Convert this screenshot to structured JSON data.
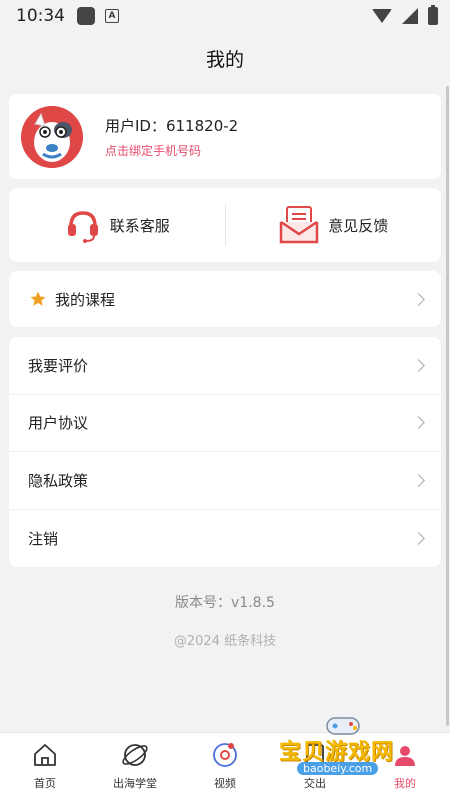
{
  "status_bar": {
    "time": "10:34",
    "notification_letter": "A"
  },
  "header": {
    "title": "我的"
  },
  "profile": {
    "user_id": "用户ID：611820-2",
    "bind_phone": "点击绑定手机号码"
  },
  "contact": {
    "service_label": "联系客服",
    "feedback_label": "意见反馈"
  },
  "course": {
    "label": "我的课程"
  },
  "menu": {
    "items": [
      {
        "label": "我要评价"
      },
      {
        "label": "用户协议"
      },
      {
        "label": "隐私政策"
      },
      {
        "label": "注销"
      }
    ]
  },
  "footer": {
    "version": "版本号：v1.8.5",
    "copyright": "@2024 纸条科技"
  },
  "tabbar": {
    "tabs": [
      {
        "label": "首页"
      },
      {
        "label": "出海学堂"
      },
      {
        "label": "视频"
      },
      {
        "label": "交出"
      },
      {
        "label": "我的"
      }
    ]
  },
  "watermark": {
    "text": "宝贝游戏网",
    "url": "baobeiy.com"
  },
  "colors": {
    "accent": "#e64a6a",
    "icon_red": "#e04848",
    "star": "#f0a020"
  }
}
